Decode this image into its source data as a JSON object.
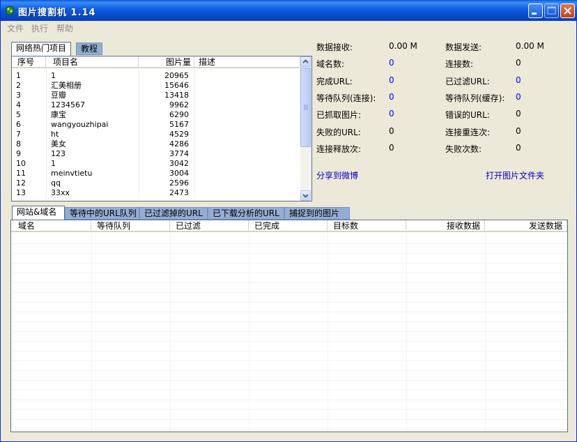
{
  "window": {
    "title": "图片搜割机  1.14"
  },
  "menu": [
    "文件",
    "执行",
    "帮助"
  ],
  "top_tabs": [
    "网络热门项目",
    "教程"
  ],
  "projects": {
    "columns": [
      "序号",
      "项目名",
      "图片量",
      "描述"
    ],
    "rows": [
      {
        "id": "1",
        "name": "1",
        "count": "20965"
      },
      {
        "id": "2",
        "name": "汇美相册",
        "count": "15646"
      },
      {
        "id": "3",
        "name": "豆瓣",
        "count": "13418"
      },
      {
        "id": "4",
        "name": "1234567",
        "count": "9962"
      },
      {
        "id": "5",
        "name": "康宝",
        "count": "6290"
      },
      {
        "id": "6",
        "name": "wangyouzhipai",
        "count": "5167"
      },
      {
        "id": "7",
        "name": "ht",
        "count": "4529"
      },
      {
        "id": "8",
        "name": "美女",
        "count": "4286"
      },
      {
        "id": "9",
        "name": "123",
        "count": "3774"
      },
      {
        "id": "10",
        "name": "1",
        "count": "3042"
      },
      {
        "id": "11",
        "name": "meinvtietu",
        "count": "3004"
      },
      {
        "id": "12",
        "name": "qq",
        "count": "2596"
      },
      {
        "id": "13",
        "name": "33xx",
        "count": "2473"
      }
    ]
  },
  "stats": {
    "left": [
      {
        "label": "数据接收:",
        "value": "0.00 M",
        "blue": false
      },
      {
        "label": "域名数:",
        "value": "0",
        "blue": true
      },
      {
        "label": "完成URL:",
        "value": "0",
        "blue": true
      },
      {
        "label": "等待队列(连接):",
        "value": "0",
        "blue": true
      },
      {
        "label": "已抓取图片:",
        "value": "0",
        "blue": true
      },
      {
        "label": "失败的URL:",
        "value": "0",
        "blue": false
      },
      {
        "label": "连接释放次:",
        "value": "0",
        "blue": false
      }
    ],
    "right": [
      {
        "label": "数据发送:",
        "value": "0.00 M",
        "blue": false
      },
      {
        "label": "连接数:",
        "value": "0",
        "blue": false
      },
      {
        "label": "已过滤URL:",
        "value": "0",
        "blue": true
      },
      {
        "label": "等待队列(缓存):",
        "value": "0",
        "blue": true
      },
      {
        "label": "错误的URL:",
        "value": "0",
        "blue": false
      },
      {
        "label": "连接重连次:",
        "value": "0",
        "blue": false
      },
      {
        "label": "失败次数:",
        "value": "0",
        "blue": false
      }
    ]
  },
  "links": {
    "share": "分享到微博",
    "open_folder": "打开图片文件夹"
  },
  "bottom_tabs": [
    "网站&域名",
    "等待中的URL队列",
    "已过滤掉的URL",
    "已下载分析的URL",
    "捕捉到的图片"
  ],
  "domains": {
    "columns": [
      "域名",
      "等待队列",
      "已过滤",
      "已完成",
      "目标数",
      "接收数据",
      "发送数据"
    ]
  }
}
